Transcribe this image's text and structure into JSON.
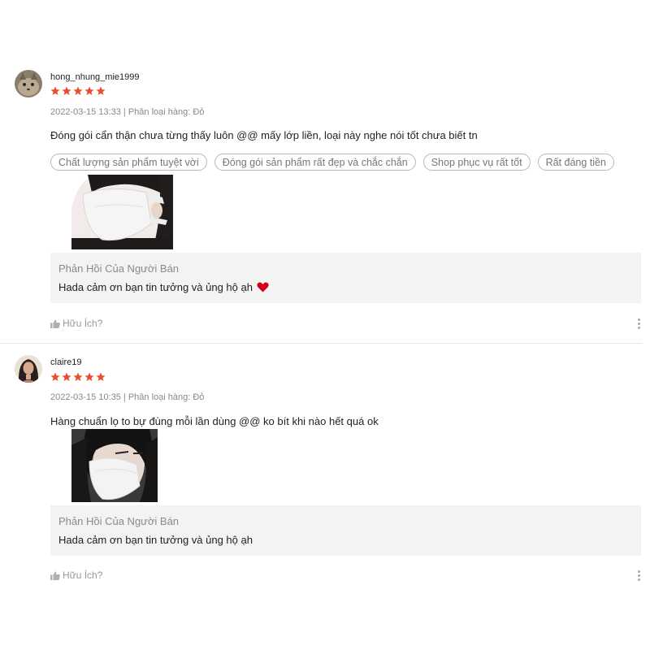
{
  "reviews": [
    {
      "username": "hong_nhung_mie1999",
      "rating": 5,
      "date": "2022-03-15 13:33",
      "variant_label": "Phân loại hàng: Đỏ",
      "comment": "Đóng gói cẩn thận chưa từng thấy luôn @@ mấy lớp liền, loại này nghe nói tốt chưa biết tn",
      "tags": [
        "Chất lượng sản phẩm tuyệt vời",
        "Đóng gói sản phẩm rất đẹp và chắc chắn",
        "Shop phục vụ rất tốt",
        "Rất đáng tiền"
      ],
      "reply": {
        "title": "Phản Hồi Của Người Bán",
        "text": "Hada cảm ơn bạn tin tưởng và ủng hộ ạh"
      },
      "helpful_label": "Hữu Ích?"
    },
    {
      "username": "claire19",
      "rating": 5,
      "date": "2022-03-15 10:35",
      "variant_label": "Phân loại hàng: Đỏ",
      "comment": "Hàng chuẩn lọ to bự đùng mỗi lần dùng @@ ko bít khi nào hết quá ok",
      "reply": {
        "title": "Phản Hồi Của Người Bán",
        "text": "Hada cảm ơn bạn tin tưởng và ủng hộ ạh"
      },
      "helpful_label": "Hữu Ích?"
    }
  ],
  "colors": {
    "star": "#ee4d2d",
    "heart": "#d0021b",
    "reply_bg": "#f3f3f3"
  }
}
